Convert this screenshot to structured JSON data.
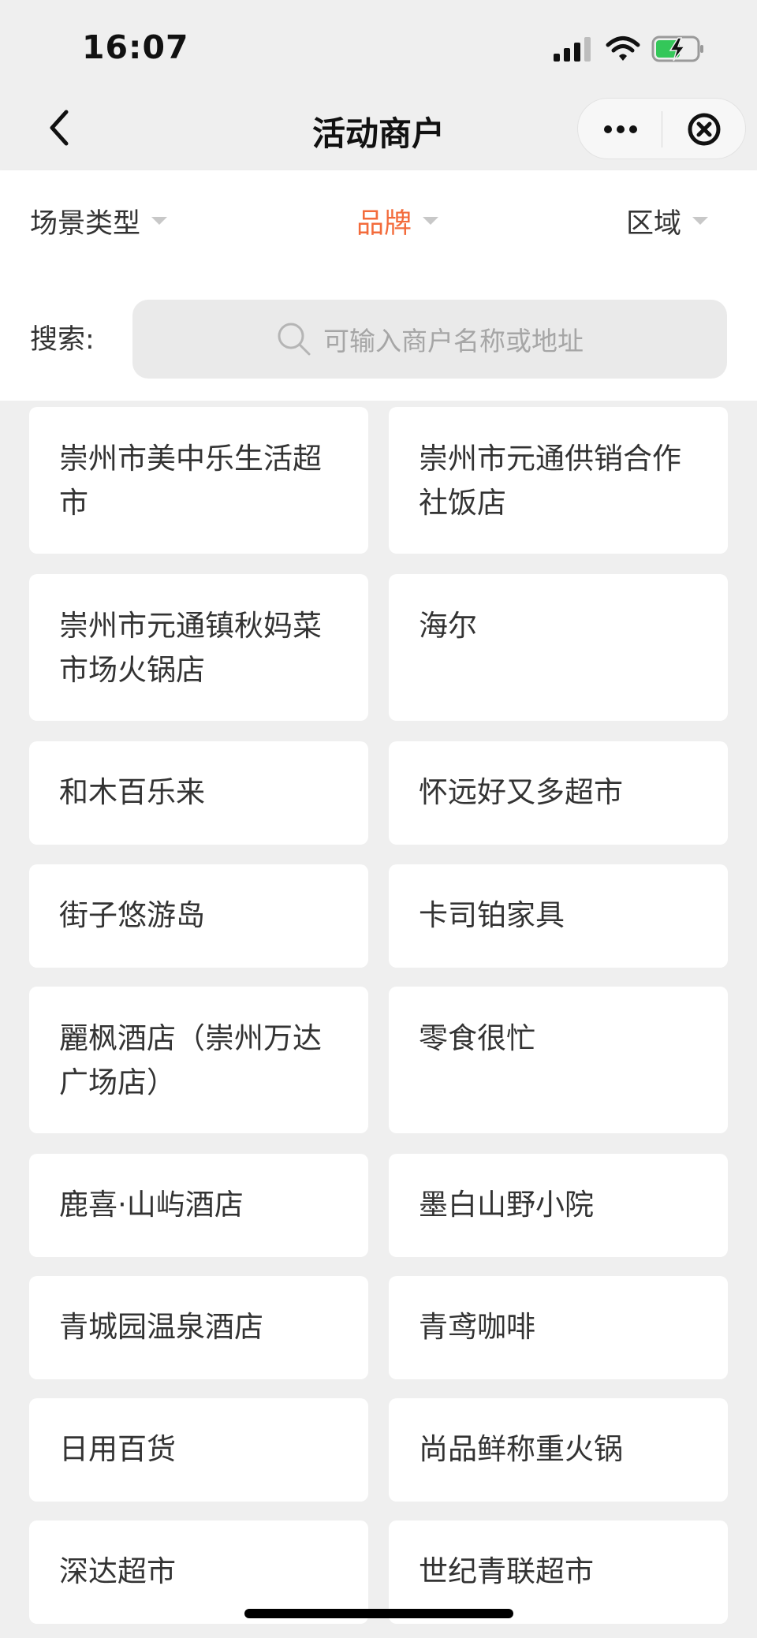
{
  "status_bar": {
    "time": "16:07"
  },
  "nav": {
    "title": "活动商户"
  },
  "filters": [
    {
      "label": "场景类型"
    },
    {
      "label": "品牌"
    },
    {
      "label": "区域"
    }
  ],
  "search": {
    "label": "搜索:",
    "placeholder": "可输入商户名称或地址"
  },
  "colors": {
    "accent": "#f36b3b",
    "background": "#efefef",
    "card": "#ffffff"
  },
  "merchants": [
    {
      "line1": "崇州市美中乐生活超",
      "line2": "市"
    },
    {
      "line1": "崇州市元通供销合作",
      "line2": "社饭店"
    },
    {
      "line1": "崇州市元通镇秋妈菜",
      "line2": "市场火锅店"
    },
    {
      "line1": "海尔",
      "line2": ""
    },
    {
      "line1": "和木百乐来",
      "line2": ""
    },
    {
      "line1": "怀远好又多超市",
      "line2": ""
    },
    {
      "line1": "街子悠游岛",
      "line2": ""
    },
    {
      "line1": "卡司铂家具",
      "line2": ""
    },
    {
      "line1": "麗枫酒店（崇州万达",
      "line2": "广场店）"
    },
    {
      "line1": "零食很忙",
      "line2": ""
    },
    {
      "line1": "鹿喜·山屿酒店",
      "line2": ""
    },
    {
      "line1": "墨白山野小院",
      "line2": ""
    },
    {
      "line1": "青城园温泉酒店",
      "line2": ""
    },
    {
      "line1": "青鸢咖啡",
      "line2": ""
    },
    {
      "line1": "日用百货",
      "line2": ""
    },
    {
      "line1": "尚品鲜称重火锅",
      "line2": ""
    },
    {
      "line1": "深达超市",
      "line2": ""
    },
    {
      "line1": "世纪青联超市",
      "line2": ""
    }
  ]
}
